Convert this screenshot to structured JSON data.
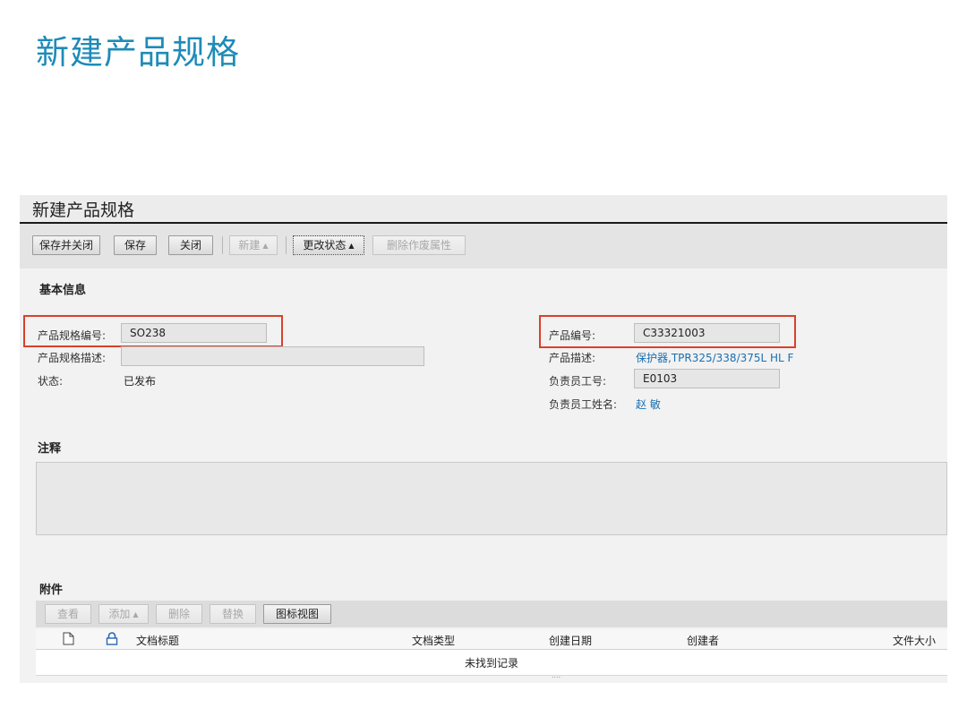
{
  "slide_title": "新建产品规格",
  "window": {
    "title": "新建产品规格"
  },
  "toolbar": {
    "save_close": "保存并关闭",
    "save": "保存",
    "close": "关闭",
    "new": "新建",
    "change_status": "更改状态",
    "delete_attr": "删除作废属性"
  },
  "basic_info": {
    "title": "基本信息",
    "spec_no_label": "产品规格编号:",
    "spec_no_value": "SO238",
    "spec_desc_label": "产品规格描述:",
    "spec_desc_value": "",
    "status_label": "状态:",
    "status_value": "已发布",
    "product_no_label": "产品编号:",
    "product_no_value": "C33321003",
    "product_desc_label": "产品描述:",
    "product_desc_value": "保护器,TPR325/338/375L HL F",
    "owner_id_label": "负责员工号:",
    "owner_id_value": "E0103",
    "owner_name_label": "负责员工姓名:",
    "owner_name_value": "赵 敏"
  },
  "notes": {
    "title": "注释"
  },
  "attachments": {
    "title": "附件",
    "view": "查看",
    "add": "添加",
    "delete": "删除",
    "replace": "替换",
    "icon_view": "图标视图",
    "columns": [
      "文档标题",
      "文档类型",
      "创建日期",
      "创建者",
      "文件大小"
    ],
    "empty": "未找到记录",
    "footer_dots": "...."
  },
  "icons": [
    "document-icon",
    "lock-icon"
  ],
  "colors": {
    "title": "#1e8bb8",
    "highlight": "#d9412b",
    "link": "#1a6fb0"
  }
}
